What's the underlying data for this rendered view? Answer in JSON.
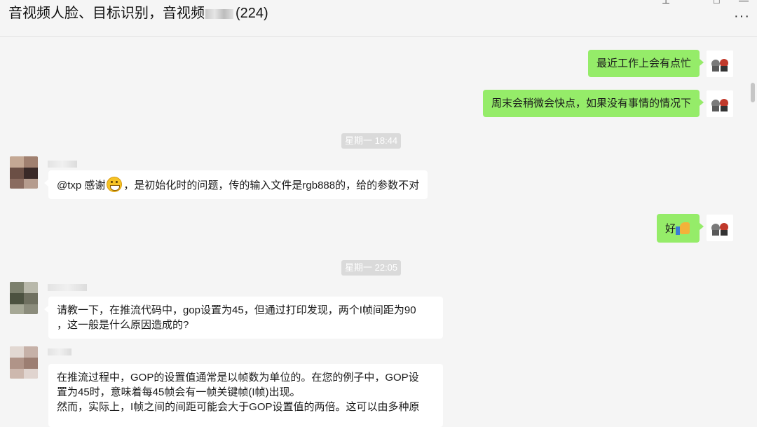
{
  "header": {
    "title_prefix": "音视频人脸、目标识别，音视频",
    "title_suffix": "(224)",
    "more_icon": "more-dots-icon"
  },
  "colors": {
    "my_bubble": "#95ec69",
    "other_bubble": "#ffffff",
    "background": "#f5f5f5",
    "time_badge": "#dadada"
  },
  "messages": {
    "m1": "最近工作上会有点忙",
    "m2": "周末会稍微会快点，如果没有事情的情况下",
    "t1": "星期一 18:44",
    "m3_a": "@txp 感谢",
    "m3_b": "，是初始化时的问题，传的输入文件是rgb888的，给的参数不对",
    "m4": "好",
    "t2": "星期一 22:05",
    "m5_l1": "请教一下，在推流代码中，gop设置为45，但通过打印发现，两个I帧间距为90",
    "m5_l2": "，这一般是什么原因造成的?",
    "m6_l1": "在推流过程中，GOP的设置值通常是以帧数为单位的。在您的例子中，GOP设",
    "m6_l2": "置为45时，意味着每45帧会有一帧关键帧(I帧)出现。",
    "m6_l3": "然而，实际上，I帧之间的间距可能会大于GOP设置值的两倍。这可以由多种原"
  }
}
